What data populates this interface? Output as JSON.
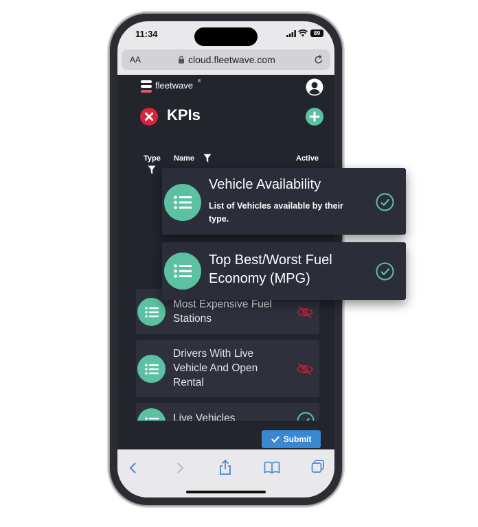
{
  "status": {
    "time": "11:34",
    "battery": "89"
  },
  "browser": {
    "text_size": "AA",
    "url": "cloud.fleetwave.com"
  },
  "app": {
    "brand": "fleetwave",
    "page_title": "KPIs",
    "columns": {
      "type": "Type",
      "name": "Name",
      "active": "Active"
    },
    "submit_label": "Submit"
  },
  "popout_cards": [
    {
      "title": "Vehicle Availability",
      "description": "List of Vehicles available by their type.",
      "status": "active"
    },
    {
      "title": "Top Best/Worst Fuel Economy (MPG)",
      "status": "active"
    }
  ],
  "list_items": [
    {
      "title": "Most Expensive Fuel Stations",
      "status": "hidden"
    },
    {
      "title": "Drivers With Live Vehicle And Open Rental",
      "status": "hidden"
    },
    {
      "title": "Live Vehicles",
      "status": "active"
    }
  ],
  "colors": {
    "accent": "#5cc1a3",
    "danger": "#d9253b",
    "primary": "#3a87d2",
    "panel": "#23252d"
  }
}
